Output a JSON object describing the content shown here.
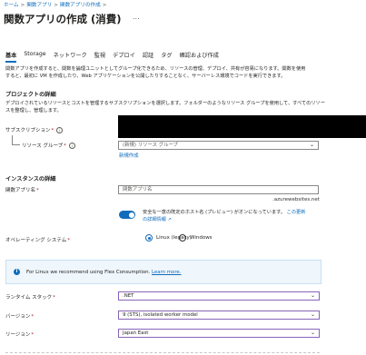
{
  "breadcrumb": [
    "ホーム",
    "関数アプリ",
    "関数アプリの作成"
  ],
  "page": {
    "title": "関数アプリの作成 (消費)",
    "more": "..."
  },
  "tabs": [
    "基本",
    "Storage",
    "ネットワーク",
    "監視",
    "デプロイ",
    "認証",
    "タグ",
    "確認および作成"
  ],
  "intro": {
    "line1": "関数アプリを作成すると、関数を論理ユニットとしてグループ化できるため、リソースの管理、デプロイ、共有が容易になります。関数を使用",
    "line2": "すると、最初に VM を作成したり、Web アプリケーションを公開したりすることなく、サーバーレス環境でコードを実行できます。"
  },
  "project": {
    "heading": "プロジェクトの詳細",
    "desc1": "デプロイされているリソースとコストを管理するサブスクリプションを選択します。フォルダーのようなリソース グループを使用して、すべてのリソー",
    "desc2": "スを整理し、管理します。",
    "subscription_label": "サブスクリプション",
    "rg_label": "リソース グループ",
    "rg_value": "(新規) リソース グループ",
    "rg_create": "新規作成"
  },
  "instance": {
    "heading": "インスタンスの詳細",
    "name_label": "関数アプリ名",
    "name_placeholder": "関数アプリ名",
    "suffix": ".azurewebsites.net",
    "toggle_text1": "安全な一意の既定のホスト名 (プレビュー) がオンになっています。",
    "toggle_link1": "この更新",
    "toggle_link2": "の詳細情報",
    "os_label": "オペレーティング システム",
    "os_options": [
      "Linux (legacy)",
      "Windows"
    ]
  },
  "banner": {
    "text": "For Linux we recommend using Flex Consumption.",
    "link": "Learn more."
  },
  "runtime": {
    "stack_label": "ランタイム スタック",
    "stack_value": ".NET",
    "version_label": "バージョン",
    "version_value": "9 (STS), isolated worker model",
    "region_label": "リージョン",
    "region_value": "Japan East"
  },
  "required_mark": "*",
  "colors": {
    "accent": "#0f6cbd",
    "required": "#a4262c",
    "selected_border": "#8764b8",
    "banner_bg": "#eff6fc"
  }
}
